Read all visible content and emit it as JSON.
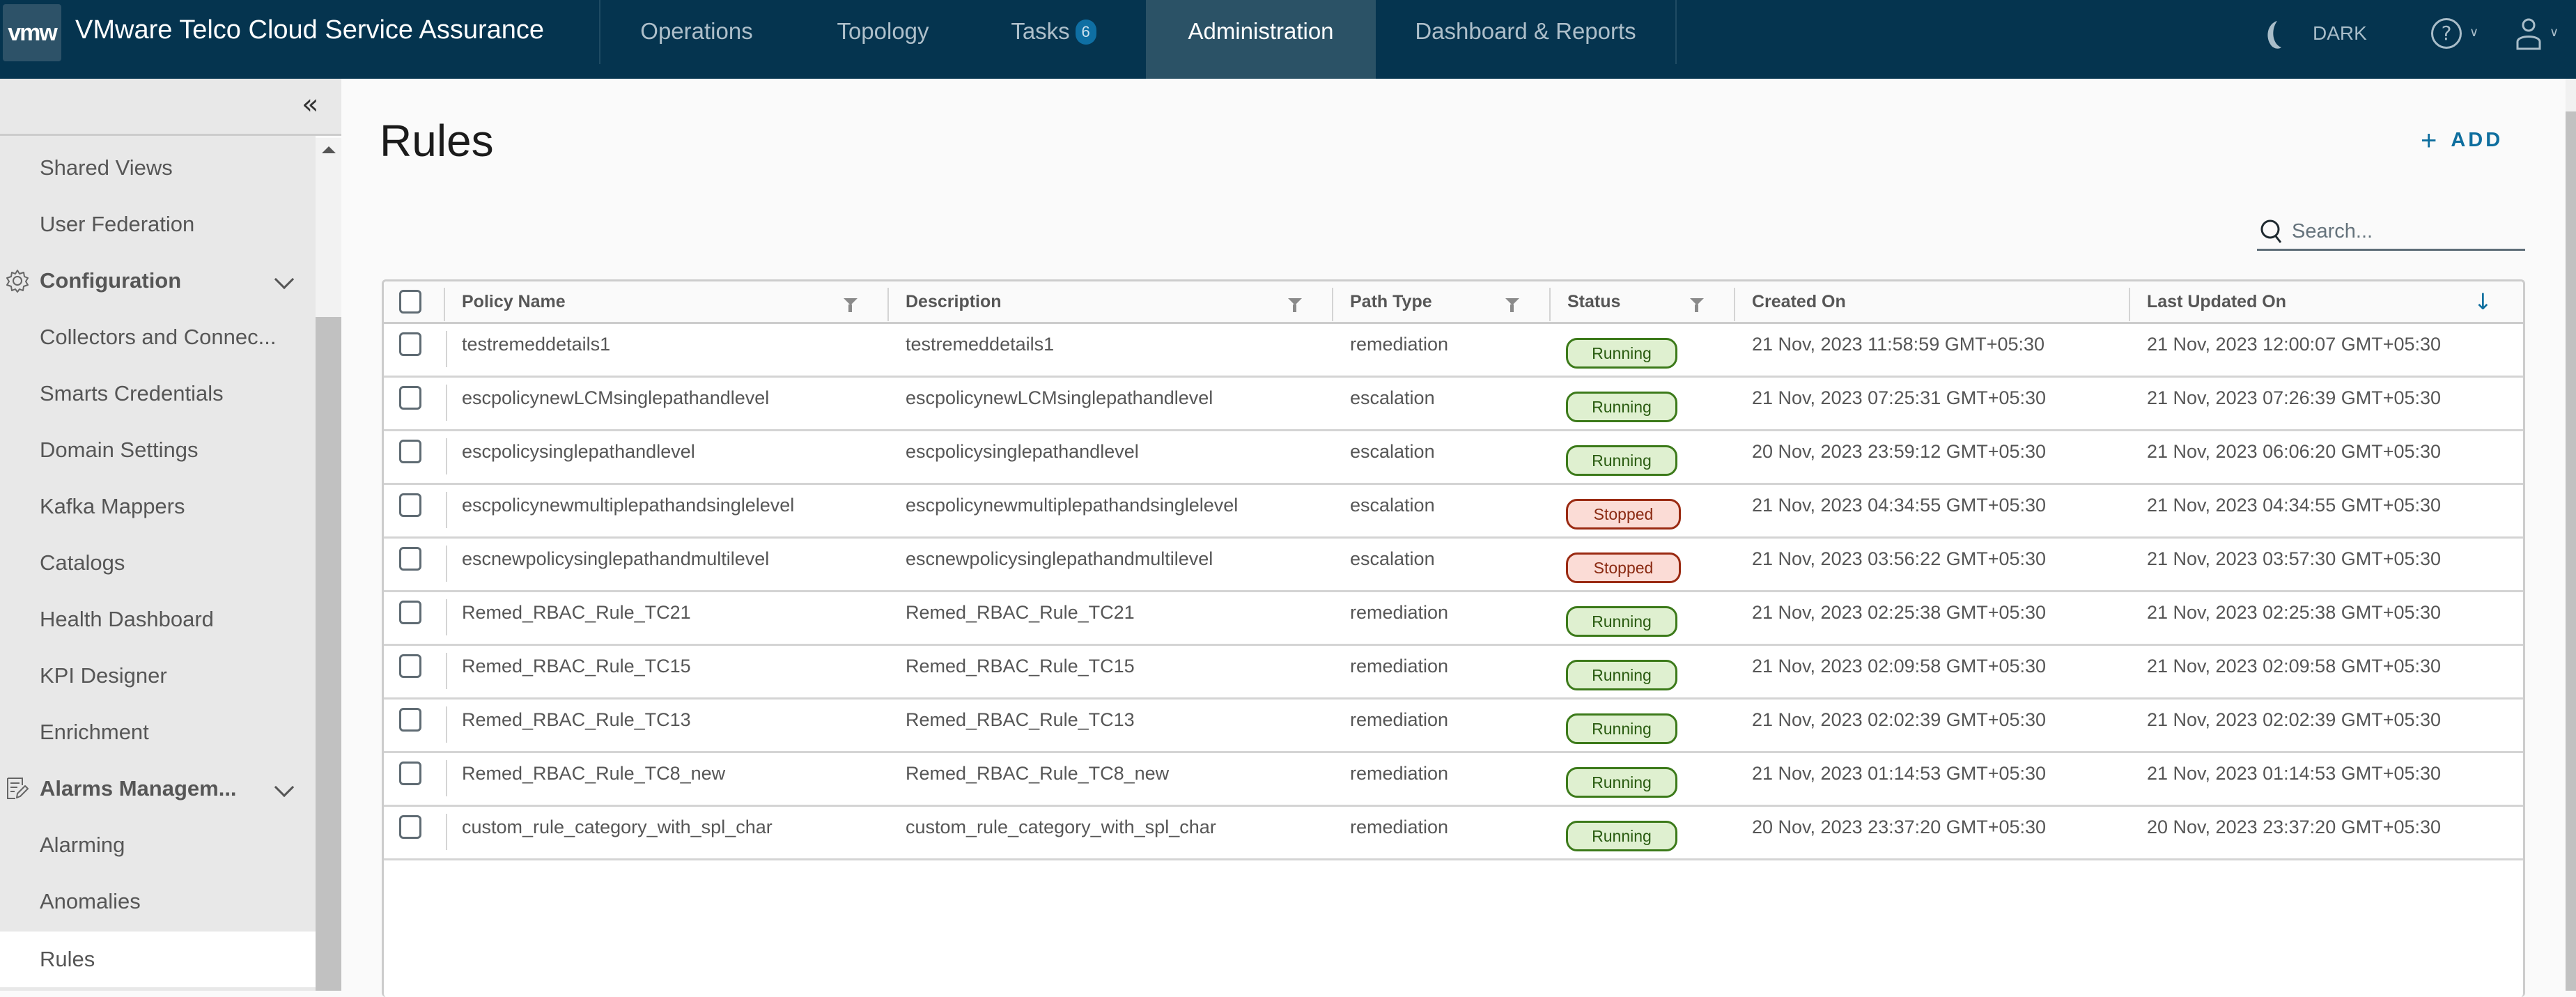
{
  "header": {
    "logo": "vmw",
    "app_title": "VMware Telco Cloud Service Assurance",
    "nav": [
      {
        "label": "Operations"
      },
      {
        "label": "Topology"
      },
      {
        "label": "Tasks",
        "badge": "6"
      },
      {
        "label": "Administration",
        "active": true
      },
      {
        "label": "Dashboard & Reports"
      }
    ],
    "theme_label": "DARK"
  },
  "sidebar": {
    "collapse_icon": "double-chevron-left",
    "items": [
      {
        "label": "Shared Views",
        "type": "item"
      },
      {
        "label": "User Federation",
        "type": "item"
      },
      {
        "label": "Configuration",
        "type": "group",
        "icon": "gear-icon",
        "expanded": true
      },
      {
        "label": "Collectors and Connec...",
        "type": "item"
      },
      {
        "label": "Smarts Credentials",
        "type": "item"
      },
      {
        "label": "Domain Settings",
        "type": "item"
      },
      {
        "label": "Kafka Mappers",
        "type": "item"
      },
      {
        "label": "Catalogs",
        "type": "item"
      },
      {
        "label": "Health Dashboard",
        "type": "item"
      },
      {
        "label": "KPI Designer",
        "type": "item"
      },
      {
        "label": "Enrichment",
        "type": "item"
      },
      {
        "label": "Alarms Managem...",
        "type": "group",
        "icon": "edit-document-icon",
        "expanded": true
      },
      {
        "label": "Alarming",
        "type": "item"
      },
      {
        "label": "Anomalies",
        "type": "item"
      },
      {
        "label": "Rules",
        "type": "item",
        "selected": true
      }
    ]
  },
  "main": {
    "title": "Rules",
    "add_label": "ADD",
    "search": {
      "placeholder": "Search...",
      "value": ""
    },
    "table": {
      "columns": [
        {
          "label": "Policy Name",
          "filter": true
        },
        {
          "label": "Description",
          "filter": true
        },
        {
          "label": "Path Type",
          "filter": true
        },
        {
          "label": "Status",
          "filter": true
        },
        {
          "label": "Created On",
          "filter": false
        },
        {
          "label": "Last Updated On",
          "filter": false,
          "sort": "descending"
        }
      ],
      "rows": [
        {
          "policy_name": "testremeddetails1",
          "description": "testremeddetails1",
          "path_type": "remediation",
          "status": "Running",
          "created_on": "21 Nov, 2023 11:58:59 GMT+05:30",
          "last_updated_on": "21 Nov, 2023 12:00:07 GMT+05:30"
        },
        {
          "policy_name": "escpolicynewLCMsinglepathandlevel",
          "description": "escpolicynewLCMsinglepathandlevel",
          "path_type": "escalation",
          "status": "Running",
          "created_on": "21 Nov, 2023 07:25:31 GMT+05:30",
          "last_updated_on": "21 Nov, 2023 07:26:39 GMT+05:30"
        },
        {
          "policy_name": "escpolicysinglepathandlevel",
          "description": "escpolicysinglepathandlevel",
          "path_type": "escalation",
          "status": "Running",
          "created_on": "20 Nov, 2023 23:59:12 GMT+05:30",
          "last_updated_on": "21 Nov, 2023 06:06:20 GMT+05:30"
        },
        {
          "policy_name": "escpolicynewmultiplepathandsinglelevel",
          "description": "escpolicynewmultiplepathandsinglelevel",
          "path_type": "escalation",
          "status": "Stopped",
          "created_on": "21 Nov, 2023 04:34:55 GMT+05:30",
          "last_updated_on": "21 Nov, 2023 04:34:55 GMT+05:30"
        },
        {
          "policy_name": "escnewpolicysinglepathandmultilevel",
          "description": "escnewpolicysinglepathandmultilevel",
          "path_type": "escalation",
          "status": "Stopped",
          "created_on": "21 Nov, 2023 03:56:22 GMT+05:30",
          "last_updated_on": "21 Nov, 2023 03:57:30 GMT+05:30"
        },
        {
          "policy_name": "Remed_RBAC_Rule_TC21",
          "description": "Remed_RBAC_Rule_TC21",
          "path_type": "remediation",
          "status": "Running",
          "created_on": "21 Nov, 2023 02:25:38 GMT+05:30",
          "last_updated_on": "21 Nov, 2023 02:25:38 GMT+05:30"
        },
        {
          "policy_name": "Remed_RBAC_Rule_TC15",
          "description": "Remed_RBAC_Rule_TC15",
          "path_type": "remediation",
          "status": "Running",
          "created_on": "21 Nov, 2023 02:09:58 GMT+05:30",
          "last_updated_on": "21 Nov, 2023 02:09:58 GMT+05:30"
        },
        {
          "policy_name": "Remed_RBAC_Rule_TC13",
          "description": "Remed_RBAC_Rule_TC13",
          "path_type": "remediation",
          "status": "Running",
          "created_on": "21 Nov, 2023 02:02:39 GMT+05:30",
          "last_updated_on": "21 Nov, 2023 02:02:39 GMT+05:30"
        },
        {
          "policy_name": "Remed_RBAC_Rule_TC8_new",
          "description": "Remed_RBAC_Rule_TC8_new",
          "path_type": "remediation",
          "status": "Running",
          "created_on": "21 Nov, 2023 01:14:53 GMT+05:30",
          "last_updated_on": "21 Nov, 2023 01:14:53 GMT+05:30"
        },
        {
          "policy_name": "custom_rule_category_with_spl_char",
          "description": "custom_rule_category_with_spl_char",
          "path_type": "remediation",
          "status": "Running",
          "created_on": "20 Nov, 2023 23:37:20 GMT+05:30",
          "last_updated_on": "20 Nov, 2023 23:37:20 GMT+05:30"
        }
      ]
    }
  },
  "colors": {
    "header_bg": "#05344f",
    "active_tab_bg": "#2b5266",
    "accent": "#0e6e9e",
    "running_bg": "#dff0d0",
    "running_border": "#3c7a1a",
    "stopped_bg": "#fbdcd6",
    "stopped_border": "#9a2a12"
  }
}
